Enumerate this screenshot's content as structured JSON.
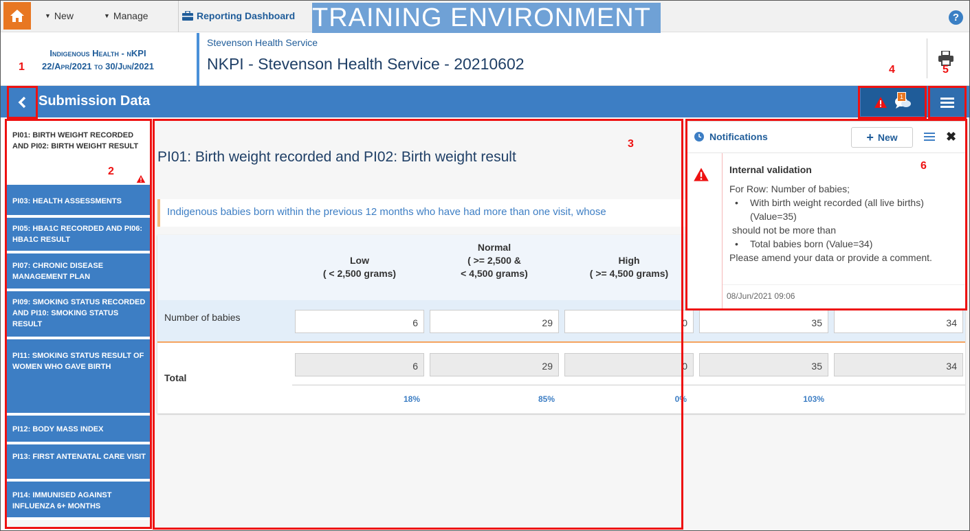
{
  "topbar": {
    "new_label": "New",
    "manage_label": "Manage",
    "reporting_label": "Reporting Dashboard",
    "training_banner": "TRAINING ENVIRONMENT",
    "help_label": "?"
  },
  "header": {
    "form_name": "Indigenous Health - nKPI",
    "period": "22/Apr/2021 to 30/Jun/2021",
    "organisation": "Stevenson Health Service",
    "submission_name": "NKPI - Stevenson Health Service - 20210602"
  },
  "bluebar": {
    "title": "Submission Data",
    "comment_count": "1"
  },
  "sidebar": {
    "items": [
      {
        "label": "PI01: Birth weight recorded and PI02: Birth weight result"
      },
      {
        "label": "PI03: Health assessments"
      },
      {
        "label": "PI05: HbA1c recorded and PI06: HbA1c result"
      },
      {
        "label": "PI07: Chronic disease management plan"
      },
      {
        "label": "PI09: Smoking status recorded and PI10: Smoking status result"
      },
      {
        "label": "PI11: Smoking status result of women who gave birth"
      },
      {
        "label": "PI12: Body mass index"
      },
      {
        "label": "PI13: First antenatal care visit"
      },
      {
        "label": "PI14: Immunised against influenza 6+ months"
      }
    ]
  },
  "main": {
    "title": "PI01: Birth weight recorded and PI02: Birth weight result",
    "description": "Indigenous babies born within the previous 12 months who have had more than one visit, whose",
    "columns": [
      {
        "line1": "",
        "line2": "Low",
        "line3": "( < 2,500 grams)"
      },
      {
        "line1": "Normal",
        "line2": "( >= 2,500 &",
        "line3": "< 4,500 grams)"
      },
      {
        "line1": "",
        "line2": "High",
        "line3": "( >= 4,500 grams)"
      }
    ],
    "row_label": "Number of babies",
    "row_values": [
      "6",
      "29",
      "0",
      "35",
      "34"
    ],
    "total_label": "Total",
    "total_values": [
      "6",
      "29",
      "0",
      "35",
      "34"
    ],
    "percentages": [
      "18%",
      "85%",
      "0%",
      "103%"
    ]
  },
  "notifications": {
    "title": "Notifications",
    "new_label": "New",
    "heading": "Internal validation",
    "line1": "For Row: Number of babies;",
    "bullet1": "With birth weight recorded (all live births) (Value=35)",
    "line2": "should not be more than",
    "bullet2": "Total babies born (Value=34)",
    "line3": "Please amend your data or provide a comment.",
    "timestamp": "08/Jun/2021 09:06"
  },
  "annotations": [
    "1",
    "2",
    "3",
    "4",
    "5",
    "6"
  ],
  "colors": {
    "accent": "#3d7ec4",
    "home": "#e87722",
    "annotation": "#ee1111",
    "warning": "#e11"
  }
}
